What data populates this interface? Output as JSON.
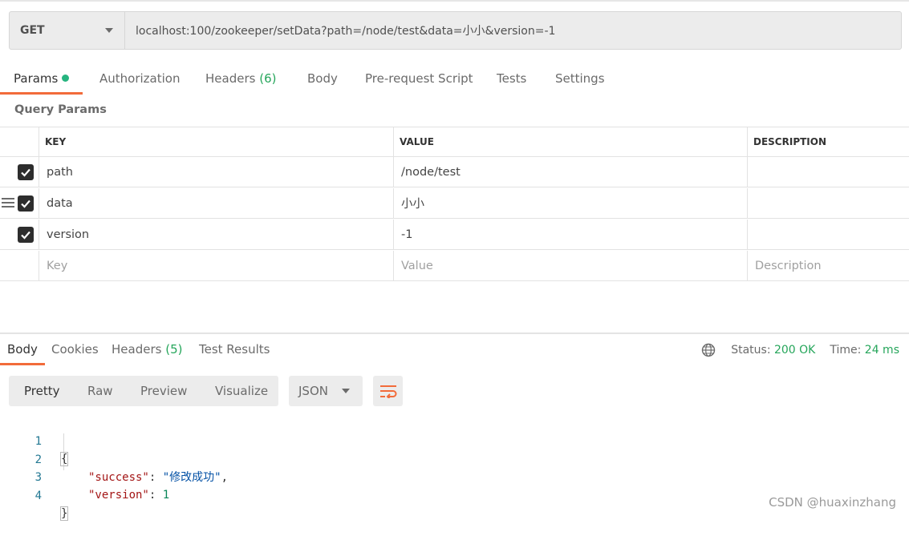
{
  "request": {
    "method": "GET",
    "url": "localhost:100/zookeeper/setData?path=/node/test&data=小小&version=-1"
  },
  "request_tabs": {
    "params": "Params",
    "authorization": "Authorization",
    "headers": "Headers",
    "headers_count": "(6)",
    "body": "Body",
    "pre_request": "Pre-request Script",
    "tests": "Tests",
    "settings": "Settings"
  },
  "query_params": {
    "label": "Query Params",
    "headers": {
      "key": "KEY",
      "value": "VALUE",
      "description": "DESCRIPTION"
    },
    "rows": [
      {
        "checked": true,
        "key": "path",
        "value": "/node/test",
        "description": ""
      },
      {
        "checked": true,
        "key": "data",
        "value": "小小",
        "description": ""
      },
      {
        "checked": true,
        "key": "version",
        "value": "-1",
        "description": ""
      }
    ],
    "placeholders": {
      "key": "Key",
      "value": "Value",
      "description": "Description"
    }
  },
  "response_tabs": {
    "body": "Body",
    "cookies": "Cookies",
    "headers": "Headers",
    "headers_count": "(5)",
    "test_results": "Test Results"
  },
  "status": {
    "status_label": "Status:",
    "status_value": "200 OK",
    "time_label": "Time:",
    "time_value": "24 ms"
  },
  "format_tabs": {
    "pretty": "Pretty",
    "raw": "Raw",
    "preview": "Preview",
    "visualize": "Visualize"
  },
  "format_select": "JSON",
  "response_body": {
    "line_numbers": [
      "1",
      "2",
      "3",
      "4"
    ],
    "open_brace": "{",
    "close_brace": "}",
    "success_key": "\"success\"",
    "success_value": "\"修改成功\"",
    "version_key": "\"version\"",
    "version_value": "1"
  },
  "watermark": "CSDN @huaxinzhang",
  "colors": {
    "accent": "#f26b3a",
    "success_green": "#26a65b",
    "checkbox": "#2d2d2d"
  }
}
